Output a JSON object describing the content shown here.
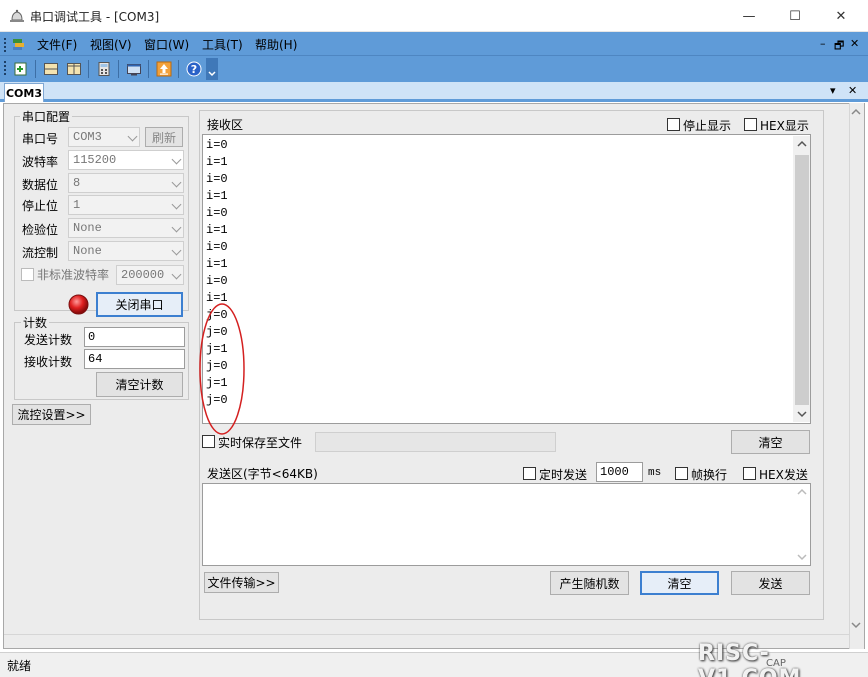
{
  "window": {
    "title": "串口调试工具 - [COM3]",
    "minimize": "—",
    "maximize": "☐",
    "close": "✕"
  },
  "menu": {
    "items": [
      "文件(F)",
      "视图(V)",
      "窗口(W)",
      "工具(T)",
      "帮助(H)"
    ],
    "mdi_min": "–",
    "mdi_restore": "🗗",
    "mdi_close": "✕"
  },
  "toolbar": {
    "icons": [
      "new-icon",
      "split-horizontal-icon",
      "split-vertical-icon",
      "calculator-icon",
      "window-icon",
      "upload-icon",
      "help-icon"
    ]
  },
  "tabs": {
    "active": "COM3",
    "pin": "▾",
    "close": "✕"
  },
  "serial_config": {
    "title": "串口配置",
    "port_label": "串口号",
    "port_value": "COM3",
    "refresh_label": "刷新",
    "baud_label": "波特率",
    "baud_value": "115200",
    "databits_label": "数据位",
    "databits_value": "8",
    "stopbits_label": "停止位",
    "stopbits_value": "1",
    "parity_label": "检验位",
    "parity_value": "None",
    "flow_label": "流控制",
    "flow_value": "None",
    "nonstd_label": "非标准波特率",
    "nonstd_value": "200000",
    "close_port_label": "关闭串口"
  },
  "count": {
    "title": "计数",
    "send_label": "发送计数",
    "send_value": "0",
    "recv_label": "接收计数",
    "recv_value": "64",
    "clear_label": "清空计数"
  },
  "flow_settings_label": "流控设置>>",
  "receive": {
    "title": "接收区",
    "stop_display_label": "停止显示",
    "hex_display_label": "HEX显示",
    "lines": [
      "i=0",
      "i=1",
      "i=0",
      "i=1",
      "i=0",
      "i=1",
      "i=0",
      "i=1",
      "i=0",
      "i=1",
      "j=0",
      "j=0",
      "j=1",
      "j=0",
      "j=1",
      "j=0"
    ],
    "save_to_file_label": "实时保存至文件",
    "save_path": "",
    "clear_label": "清空",
    "annotation_color": "#d42020"
  },
  "send": {
    "title": "发送区(字节<64KB)",
    "timed_send_label": "定时发送",
    "interval_value": "1000",
    "interval_unit": "ms",
    "frame_newline_label": "帧换行",
    "hex_send_label": "HEX发送",
    "text": "",
    "file_transfer_label": "文件传输>>",
    "random_label": "产生随机数",
    "clear_label": "清空",
    "send_label": "发送"
  },
  "status": {
    "text": "就绪",
    "caps": "CAP",
    "watermark": "RISC-V1.COM"
  },
  "colors": {
    "accent": "#5f9bd8",
    "led_red": "#e02020"
  }
}
